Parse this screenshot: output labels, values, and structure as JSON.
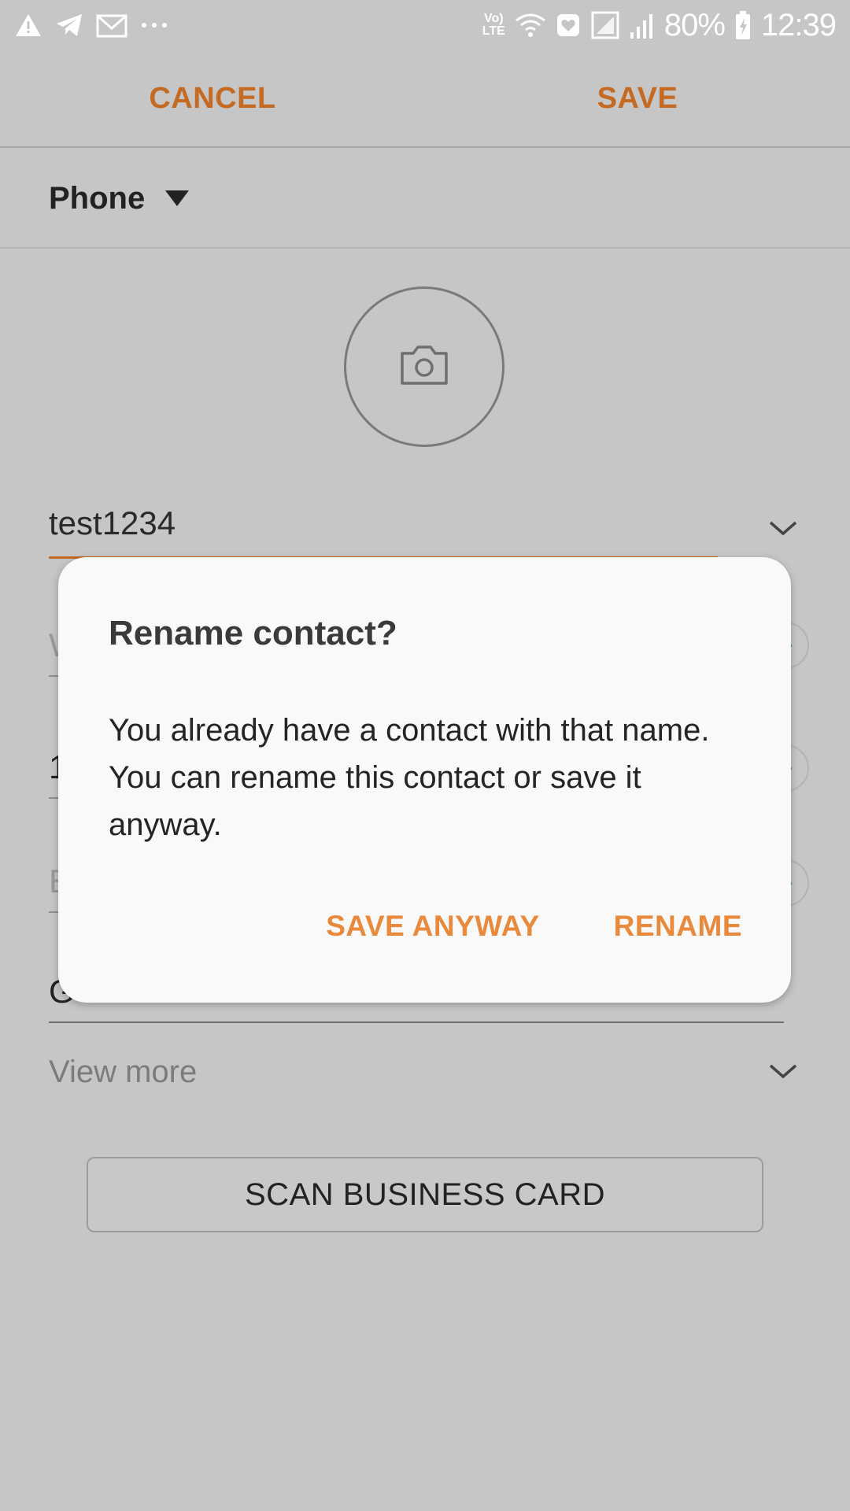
{
  "status_bar": {
    "volte_label_top": "Vo)",
    "volte_label_bottom": "LTE",
    "battery_percent": "80%",
    "time": "12:39",
    "icons": [
      "warning-icon",
      "telegram-icon",
      "gmail-icon",
      "more-dots-icon",
      "volte-icon",
      "wifi-icon",
      "heart-app-icon",
      "sim-icon",
      "signal-icon",
      "battery-charging-icon"
    ]
  },
  "action_bar": {
    "cancel_label": "CANCEL",
    "save_label": "SAVE"
  },
  "account": {
    "label": "Phone"
  },
  "contact": {
    "name_value": "test1234",
    "background_field_chars": [
      "W",
      "1",
      "E",
      "G"
    ]
  },
  "view_more_label": "View more",
  "scan_button_label": "SCAN BUSINESS CARD",
  "dialog": {
    "title": "Rename contact?",
    "body": "You already have a contact with that name. You can rename this contact or save it anyway.",
    "save_anyway_label": "SAVE ANYWAY",
    "rename_label": "RENAME"
  },
  "colors": {
    "accent": "#c46a22",
    "dialog_button": "#e9893b",
    "scrim_background": "#c6c6c6",
    "remove_green": "#39a845"
  }
}
